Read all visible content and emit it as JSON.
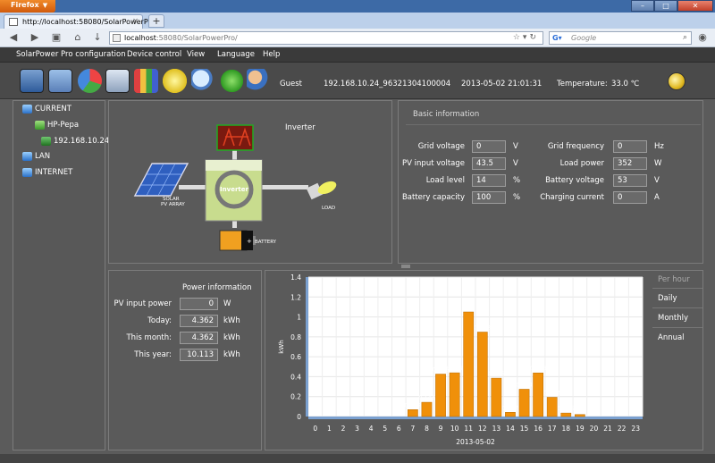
{
  "browser": {
    "menu_button": "Firefox",
    "tab_title": "http://localhost:58080/SolarPowerPro/",
    "new_tab": "+",
    "url_host": "localhost",
    "url_path": ":58080/SolarPowerPro/",
    "search_placeholder": "Google"
  },
  "menu": {
    "items": [
      "SolarPower Pro configuration",
      "Device control",
      "View",
      "Language",
      "Help"
    ]
  },
  "toolbar": {
    "user": "Guest",
    "device_id": "192.168.10.24_96321304100004",
    "datetime": "2013-05-02 21:01:31",
    "temperature_label": "Temperature:",
    "temperature_value": "33.0 ℃"
  },
  "tree": {
    "current": "CURRENT",
    "host": "HP-Pepa",
    "device": "192.168.10.24_",
    "lan": "LAN",
    "internet": "INTERNET"
  },
  "inverter": {
    "title": "Inverter",
    "box_label": "Inverter",
    "solar_label_1": "SOLAR",
    "solar_label_2": "PV ARRAY",
    "load_label": "LOAD",
    "battery_label": "BATTERY"
  },
  "basic": {
    "header": "Basic information",
    "left": [
      {
        "label": "Grid voltage",
        "value": "0",
        "unit": "V"
      },
      {
        "label": "PV input voltage",
        "value": "43.5",
        "unit": "V"
      },
      {
        "label": "Load level",
        "value": "14",
        "unit": "%"
      },
      {
        "label": "Battery capacity",
        "value": "100",
        "unit": "%"
      }
    ],
    "right": [
      {
        "label": "Grid frequency",
        "value": "0",
        "unit": "Hz"
      },
      {
        "label": "Load power",
        "value": "352",
        "unit": "W"
      },
      {
        "label": "Battery voltage",
        "value": "53",
        "unit": "V"
      },
      {
        "label": "Charging current",
        "value": "0",
        "unit": "A"
      }
    ]
  },
  "power": {
    "title": "Power information",
    "rows": [
      {
        "label": "PV input power",
        "value": "0",
        "unit": "W"
      },
      {
        "label": "Today:",
        "value": "4.362",
        "unit": "kWh"
      },
      {
        "label": "This month:",
        "value": "4.362",
        "unit": "kWh"
      },
      {
        "label": "This year:",
        "value": "10.113",
        "unit": "kWh"
      }
    ]
  },
  "periods": [
    "Per hour",
    "Daily",
    "Monthly",
    "Annual"
  ],
  "chart_data": {
    "type": "bar",
    "xlabel": "2013-05-02",
    "ylabel": "kWh",
    "ylim": [
      0,
      1.4
    ],
    "yticks": [
      "0",
      "0.2",
      "0.4",
      "0.6",
      "0.8",
      "1",
      "1.2",
      "1.4"
    ],
    "categories": [
      "0",
      "1",
      "2",
      "3",
      "4",
      "5",
      "6",
      "7",
      "8",
      "9",
      "10",
      "11",
      "12",
      "13",
      "14",
      "15",
      "16",
      "17",
      "18",
      "19",
      "20",
      "21",
      "22",
      "23"
    ],
    "values": [
      0,
      0,
      0,
      0,
      0,
      0,
      0,
      0.069,
      0.143,
      0.426,
      0.439,
      1.05,
      0.848,
      0.385,
      0.042,
      0.274,
      0.438,
      0.193,
      0.035,
      0.02,
      0,
      0,
      0,
      0
    ],
    "labels": [
      "",
      "",
      "",
      "",
      "",
      "",
      "",
      "0.069",
      "0.143",
      "0.426",
      "0.439",
      "1.05",
      "0.848",
      "0.385",
      "0.042",
      "0.274",
      "0.438",
      "0.193",
      "0.035",
      "0.02",
      "",
      "",
      "",
      ""
    ],
    "bar_color": "#f0900a",
    "grid": true
  }
}
